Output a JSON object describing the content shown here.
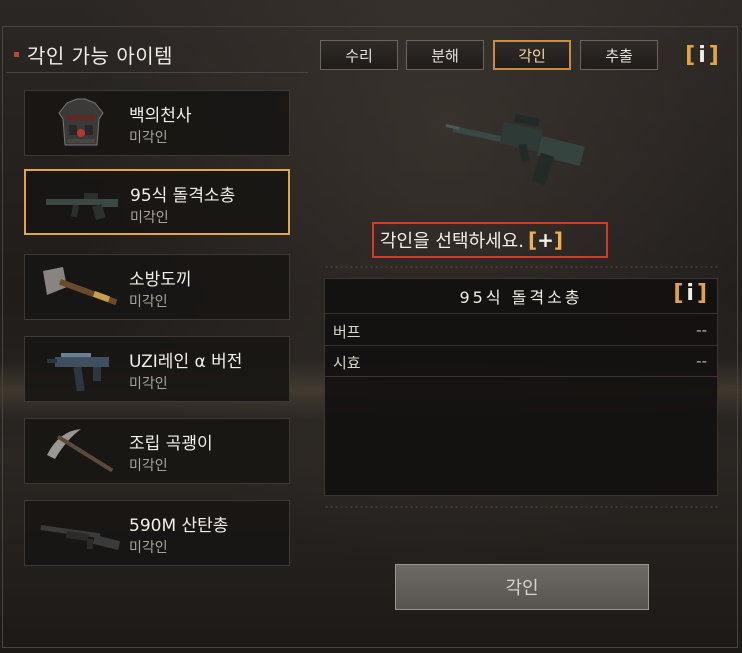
{
  "panel": {
    "title": "각인 가능 아이템"
  },
  "items": [
    {
      "name": "백의천사",
      "status": "미각인",
      "icon": "vest-icon"
    },
    {
      "name": "95식 돌격소총",
      "status": "미각인",
      "icon": "rifle-icon",
      "selected": true
    },
    {
      "name": "소방도끼",
      "status": "미각인",
      "icon": "axe-icon"
    },
    {
      "name": "UZI레인 α 버전",
      "status": "미각인",
      "icon": "smg-icon"
    },
    {
      "name": "조립 곡괭이",
      "status": "미각인",
      "icon": "pickaxe-icon"
    },
    {
      "name": "590M 산탄총",
      "status": "미각인",
      "icon": "shotgun-icon"
    }
  ],
  "tabs": [
    {
      "label": "수리",
      "active": false
    },
    {
      "label": "분해",
      "active": false
    },
    {
      "label": "각인",
      "active": true
    },
    {
      "label": "추출",
      "active": false
    }
  ],
  "info_icon": "i",
  "prompt": {
    "text": "각인을 선택하세요.",
    "plus": "+"
  },
  "stats": {
    "title": "95식 돌격소총",
    "rows": [
      {
        "label": "버프",
        "value": "--"
      },
      {
        "label": "시효",
        "value": "--"
      }
    ]
  },
  "engrave_button": {
    "label": "각인"
  },
  "colors": {
    "accent": "#e2a64a",
    "highlight": "#d23b2c"
  }
}
